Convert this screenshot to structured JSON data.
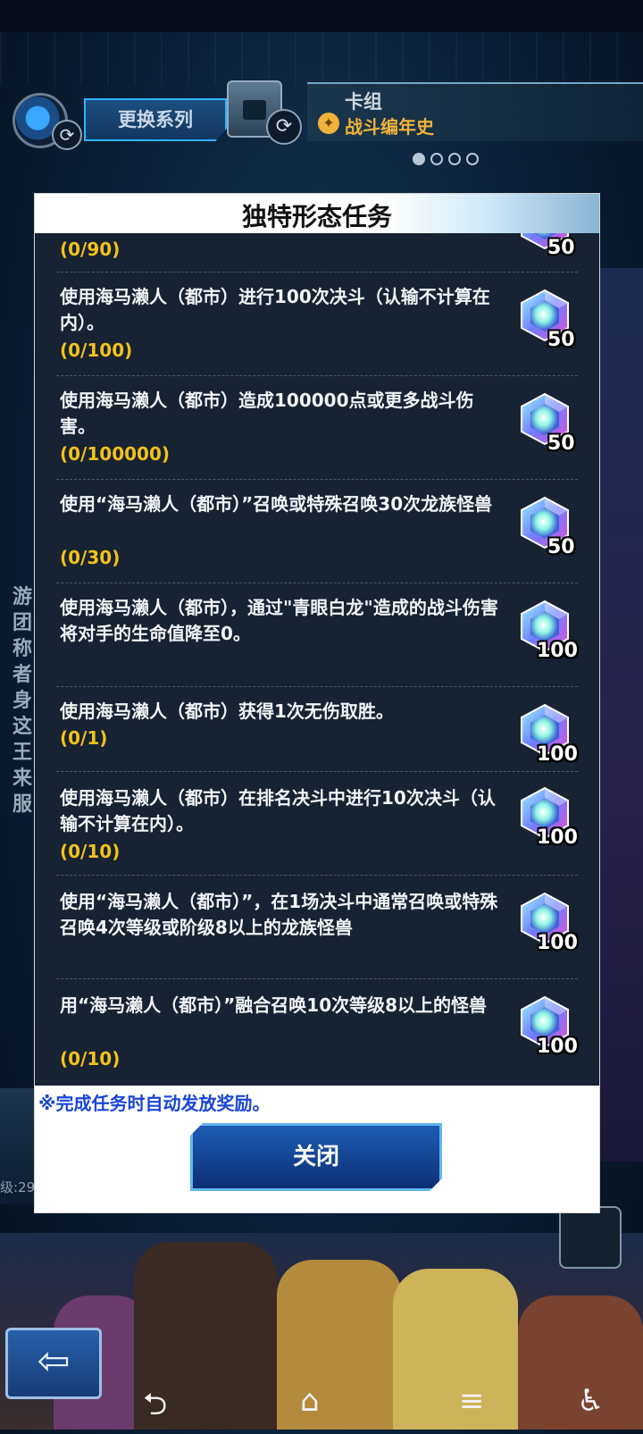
{
  "background": {
    "series_button_label": "更换系列",
    "deck_label": "卡组",
    "deck_name": "战斗编年史",
    "side_text": "游团称者身这王来服",
    "left_level_text": "级:29"
  },
  "modal": {
    "title": "独特形态任务",
    "tasks": [
      {
        "text": "",
        "progress": "(0/90)",
        "reward": "50"
      },
      {
        "text": "使用海马濑人（都市）进行100次决斗（认输不计算在内）。",
        "progress": "(0/100)",
        "reward": "50"
      },
      {
        "text": "使用海马濑人（都市）造成100000点或更多战斗伤害。",
        "progress": "(0/100000)",
        "reward": "50"
      },
      {
        "text": "使用“海马濑人（都市）”召唤或特殊召唤30次龙族怪兽",
        "progress": "(0/30)",
        "reward": "50"
      },
      {
        "text": "使用海马濑人（都市），通过\"青眼白龙\"造成的战斗伤害将对手的生命值降至0。",
        "progress": "",
        "reward": "100"
      },
      {
        "text": "使用海马濑人（都市）获得1次无伤取胜。",
        "progress": "(0/1)",
        "reward": "100"
      },
      {
        "text": "使用海马濑人（都市）在排名决斗中进行10次决斗（认输不计算在内）。",
        "progress": "(0/10)",
        "reward": "100"
      },
      {
        "text": "使用“海马濑人（都市）”，在1场决斗中通常召唤或特殊召唤4次等级或阶级8以上的龙族怪兽",
        "progress": "",
        "reward": "100"
      },
      {
        "text": "用“海马濑人（都市）”融合召唤10次等级8以上的怪兽",
        "progress": "(0/10)",
        "reward": "100"
      }
    ],
    "note": "※完成任务时自动发放奖励。",
    "close_label": "关闭"
  },
  "colors": {
    "progress": "#f1c21b",
    "note": "#1a46d6",
    "list_bg": "#172232"
  },
  "icons": {
    "reward": "crystal-gem-icon",
    "back": "back-arrow-icon",
    "refresh": "refresh-icon"
  }
}
